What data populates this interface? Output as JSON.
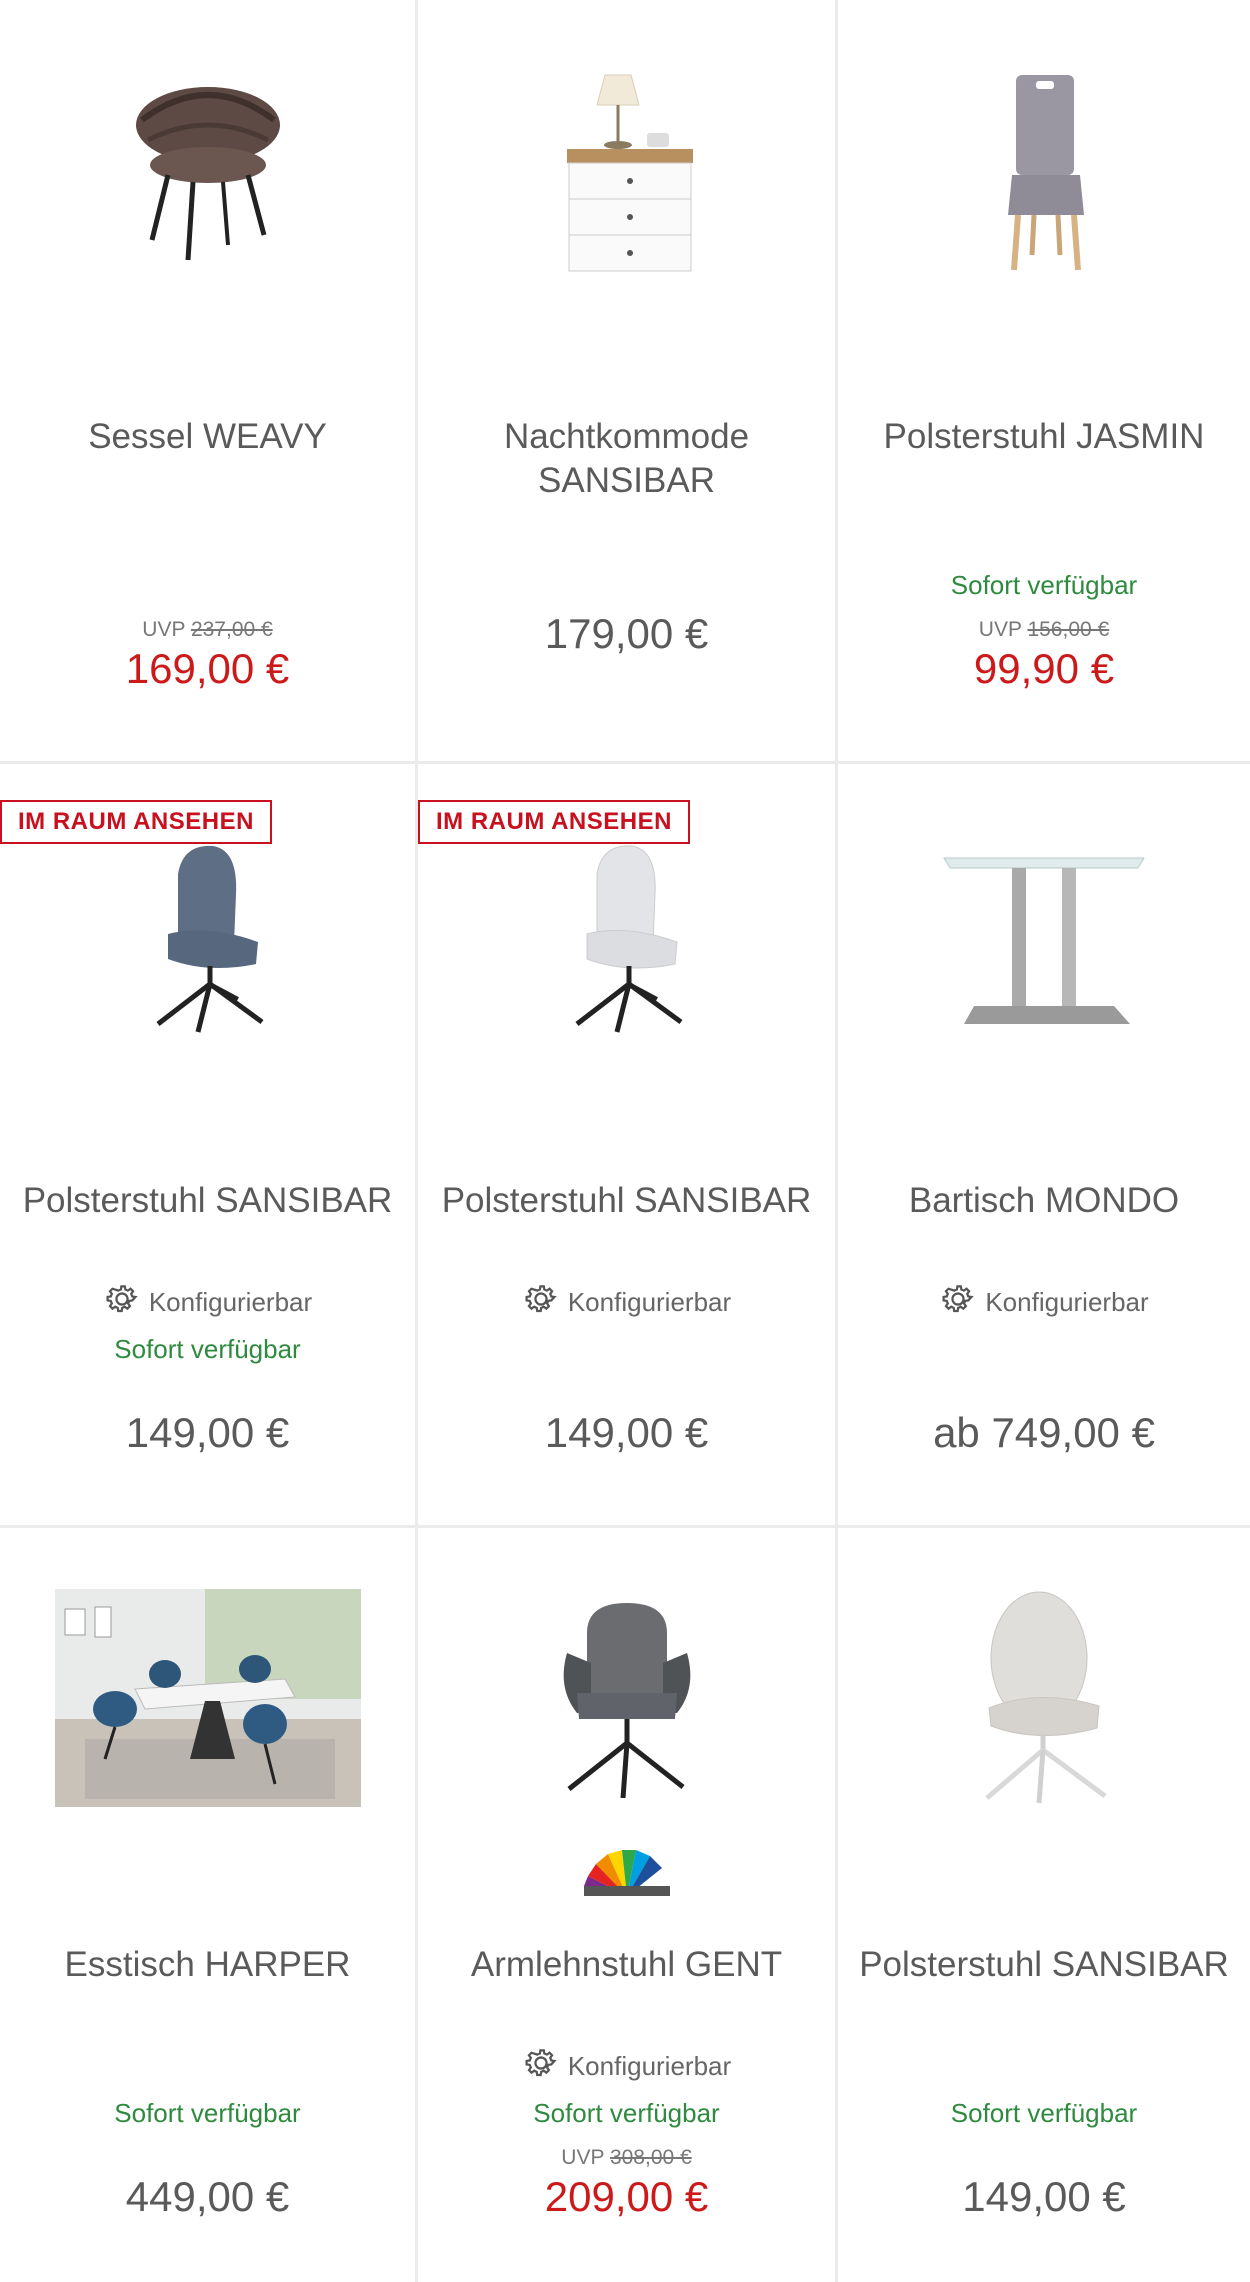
{
  "products": [
    {
      "title": "Sessel WEAVY",
      "uvp_label": "UVP",
      "uvp": "237,00 €",
      "price": "169,00 €"
    },
    {
      "title": "Nachtkommode SANSIBAR",
      "price": "179,00 €"
    },
    {
      "title": "Polsterstuhl JASMIN",
      "availability": "Sofort verfügbar",
      "uvp_label": "UVP",
      "uvp": "156,00 €",
      "price": "99,90 €"
    },
    {
      "badge": "IM RAUM ANSEHEN",
      "title": "Polsterstuhl SANSIBAR",
      "config": "Konfigurierbar",
      "availability": "Sofort verfügbar",
      "price": "149,00 €"
    },
    {
      "badge": "IM RAUM ANSEHEN",
      "title": "Polsterstuhl SANSIBAR",
      "config": "Konfigurierbar",
      "price": "149,00 €"
    },
    {
      "title": "Bartisch MONDO",
      "config": "Konfigurierbar",
      "price": "ab 749,00 €"
    },
    {
      "title": "Esstisch HARPER",
      "availability": "Sofort verfügbar",
      "price": "449,00 €"
    },
    {
      "title": "Armlehnstuhl GENT",
      "config": "Konfigurierbar",
      "availability": "Sofort verfügbar",
      "uvp_label": "UVP",
      "uvp": "308,00 €",
      "price": "209,00 €"
    },
    {
      "title": "Polsterstuhl SANSIBAR",
      "availability": "Sofort verfügbar",
      "price": "149,00 €"
    }
  ],
  "colors": {
    "sale": "#cc1a1a",
    "available": "#2f8a3f",
    "badge": "#c8101e",
    "text": "#5a5a5a"
  }
}
